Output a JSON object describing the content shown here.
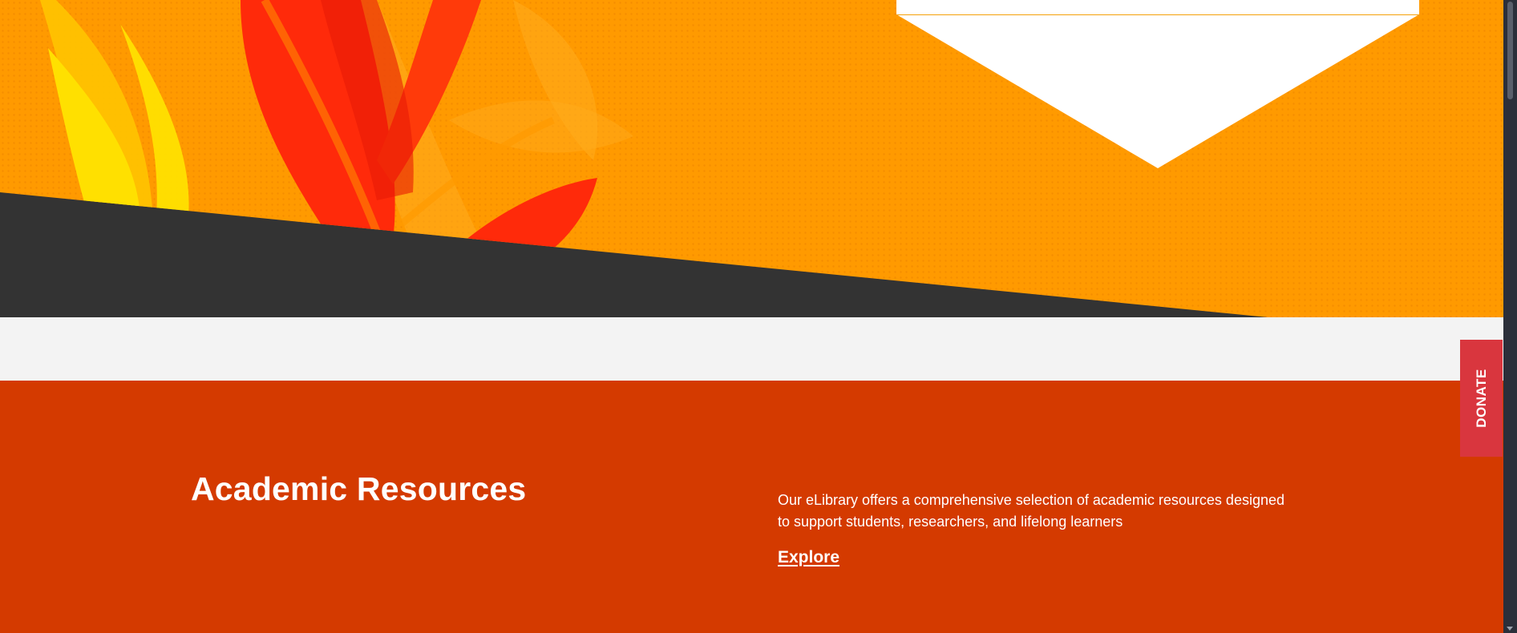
{
  "colors": {
    "hero_orange": "#ff9a00",
    "hero_dark": "#333333",
    "leaf_red": "#ff2a0a",
    "leaf_yellow": "#ffe000",
    "section_bg": "#d43a00",
    "donate_bg": "#d9363e",
    "light_band": "#f3f3f3"
  },
  "resources": {
    "title": "Academic Resources",
    "description": "Our eLibrary offers a comprehensive selection of academic resources designed to support students, researchers, and lifelong learners",
    "link_label": "Explore"
  },
  "donate": {
    "label": "DONATE"
  },
  "icons": {
    "scroll_down": "chevron-down-icon"
  }
}
